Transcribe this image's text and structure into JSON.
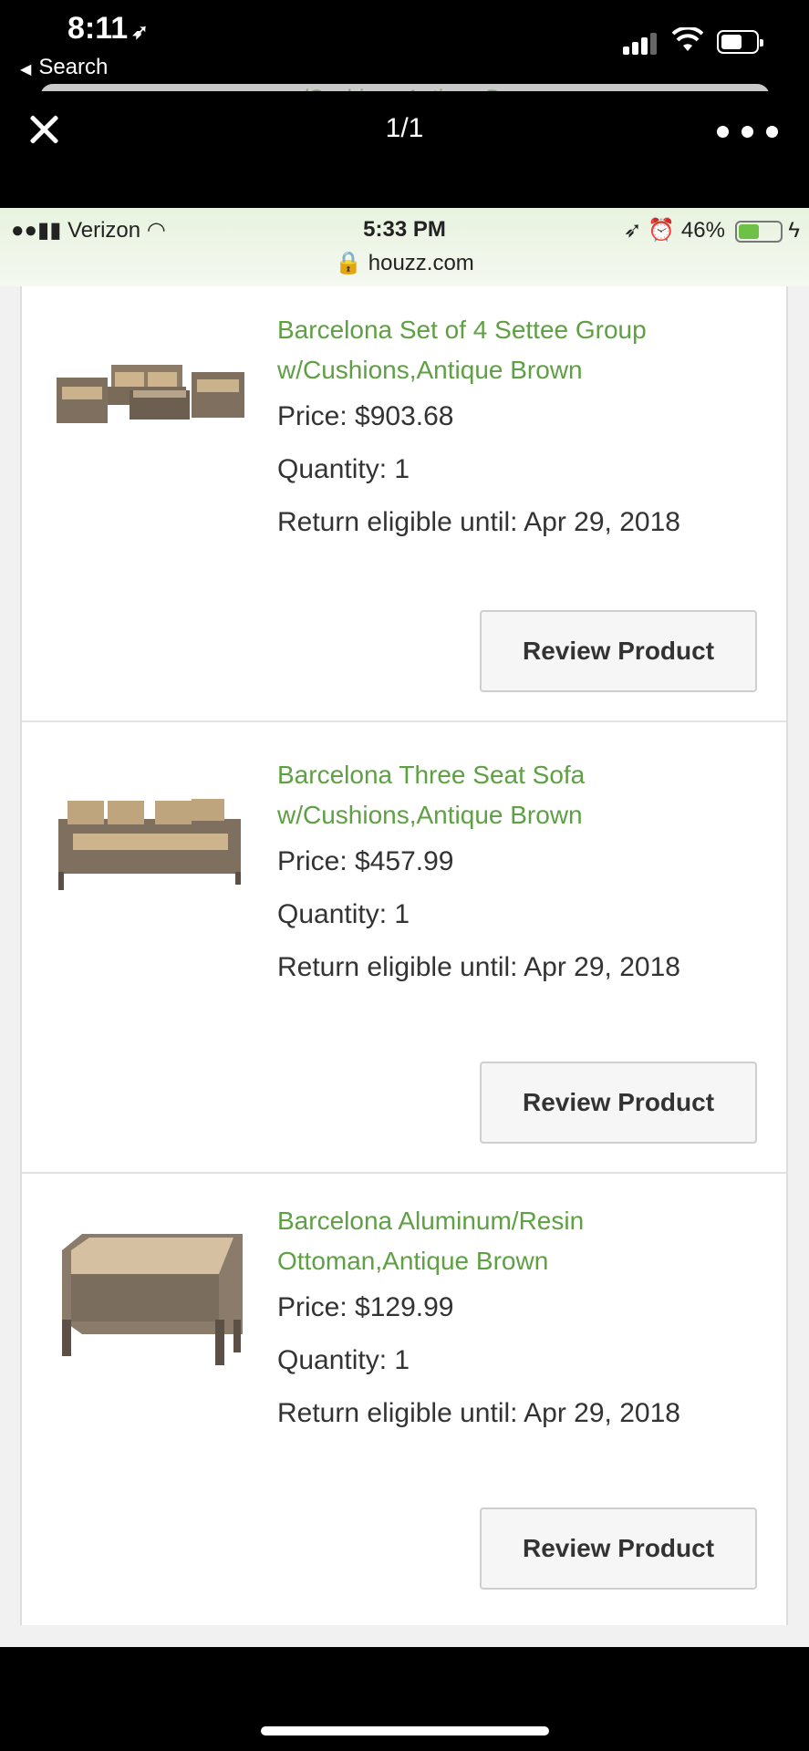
{
  "outer_status": {
    "time": "8:11",
    "back_label": "Search"
  },
  "peek_text": "w/Cushions,Antique Brown",
  "viewer": {
    "counter": "1/1"
  },
  "inner_status": {
    "carrier": "Verizon",
    "time": "5:33 PM",
    "url": "houzz.com",
    "battery": "46%"
  },
  "items": [
    {
      "title_line1": "Barcelona Set of 4 Settee Group",
      "title_line2": "w/Cushions,Antique Brown",
      "price": "Price: $903.68",
      "quantity": "Quantity: 1",
      "return": "Return eligible until: Apr 29, 2018",
      "button": "Review Product"
    },
    {
      "title_line1": "Barcelona Three Seat Sofa",
      "title_line2": "w/Cushions,Antique Brown",
      "price": "Price: $457.99",
      "quantity": "Quantity: 1",
      "return": "Return eligible until: Apr 29, 2018",
      "button": "Review Product"
    },
    {
      "title_line1": "Barcelona Aluminum/Resin",
      "title_line2": "Ottoman,Antique Brown",
      "price": "Price: $129.99",
      "quantity": "Quantity: 1",
      "return": "Return eligible until: Apr 29, 2018",
      "button": "Review Product"
    }
  ]
}
